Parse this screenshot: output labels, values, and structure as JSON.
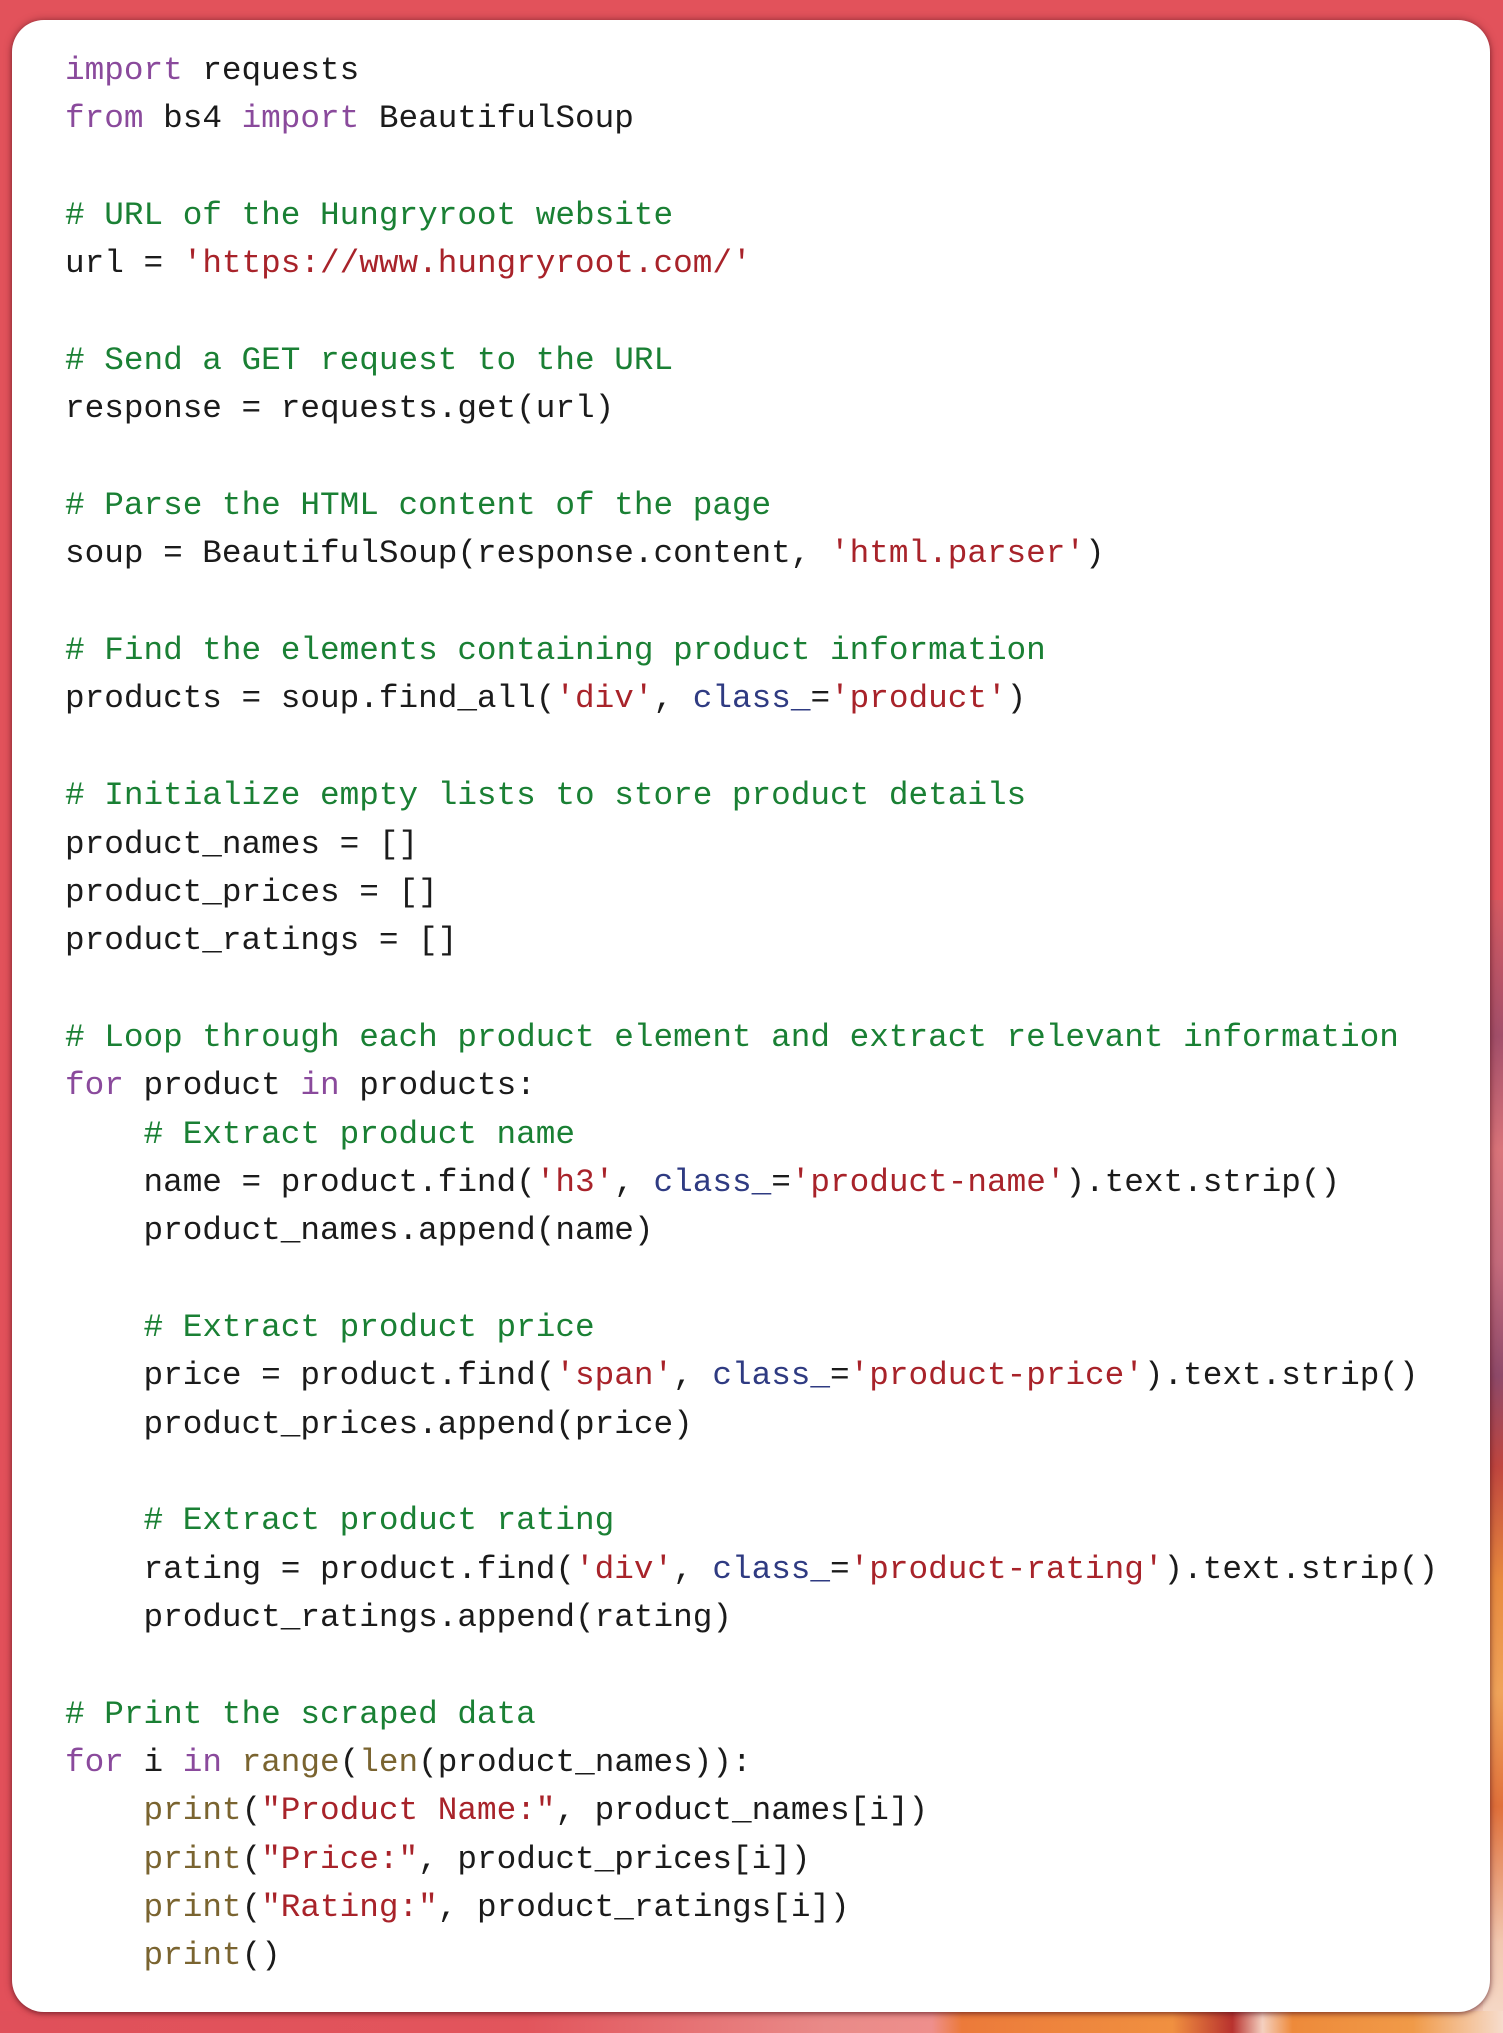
{
  "colors": {
    "keyword": "#8a4a9c",
    "comment": "#1a8034",
    "string": "#a8232a",
    "builtin": "#7a6430",
    "param": "#2f3b82",
    "plain": "#1b1b1b",
    "card_background": "#ffffff",
    "frame_background": "#e2525b"
  },
  "code": {
    "language": "python",
    "lines": [
      [
        [
          "keyword",
          "import"
        ],
        [
          "plain",
          " requests"
        ]
      ],
      [
        [
          "keyword",
          "from"
        ],
        [
          "plain",
          " bs4 "
        ],
        [
          "keyword",
          "import"
        ],
        [
          "plain",
          " BeautifulSoup"
        ]
      ],
      [],
      [
        [
          "comment",
          "# URL of the Hungryroot website"
        ]
      ],
      [
        [
          "plain",
          "url = "
        ],
        [
          "string",
          "'https://www.hungryroot.com/'"
        ]
      ],
      [],
      [
        [
          "comment",
          "# Send a GET request to the URL"
        ]
      ],
      [
        [
          "plain",
          "response = requests.get(url)"
        ]
      ],
      [],
      [
        [
          "comment",
          "# Parse the HTML content of the page"
        ]
      ],
      [
        [
          "plain",
          "soup = BeautifulSoup(response.content, "
        ],
        [
          "string",
          "'html.parser'"
        ],
        [
          "plain",
          ")"
        ]
      ],
      [],
      [
        [
          "comment",
          "# Find the elements containing product information"
        ]
      ],
      [
        [
          "plain",
          "products = soup.find_all("
        ],
        [
          "string",
          "'div'"
        ],
        [
          "plain",
          ", "
        ],
        [
          "param",
          "class_"
        ],
        [
          "plain",
          "="
        ],
        [
          "string",
          "'product'"
        ],
        [
          "plain",
          ")"
        ]
      ],
      [],
      [
        [
          "comment",
          "# Initialize empty lists to store product details"
        ]
      ],
      [
        [
          "plain",
          "product_names = []"
        ]
      ],
      [
        [
          "plain",
          "product_prices = []"
        ]
      ],
      [
        [
          "plain",
          "product_ratings = []"
        ]
      ],
      [],
      [
        [
          "comment",
          "# Loop through each product element and extract relevant information"
        ]
      ],
      [
        [
          "keyword",
          "for"
        ],
        [
          "plain",
          " product "
        ],
        [
          "keyword",
          "in"
        ],
        [
          "plain",
          " products:"
        ]
      ],
      [
        [
          "plain",
          "    "
        ],
        [
          "comment",
          "# Extract product name"
        ]
      ],
      [
        [
          "plain",
          "    name = product.find("
        ],
        [
          "string",
          "'h3'"
        ],
        [
          "plain",
          ", "
        ],
        [
          "param",
          "class_"
        ],
        [
          "plain",
          "="
        ],
        [
          "string",
          "'product-name'"
        ],
        [
          "plain",
          ").text.strip()"
        ]
      ],
      [
        [
          "plain",
          "    product_names.append(name)"
        ]
      ],
      [],
      [
        [
          "plain",
          "    "
        ],
        [
          "comment",
          "# Extract product price"
        ]
      ],
      [
        [
          "plain",
          "    price = product.find("
        ],
        [
          "string",
          "'span'"
        ],
        [
          "plain",
          ", "
        ],
        [
          "param",
          "class_"
        ],
        [
          "plain",
          "="
        ],
        [
          "string",
          "'product-price'"
        ],
        [
          "plain",
          ").text.strip()"
        ]
      ],
      [
        [
          "plain",
          "    product_prices.append(price)"
        ]
      ],
      [],
      [
        [
          "plain",
          "    "
        ],
        [
          "comment",
          "# Extract product rating"
        ]
      ],
      [
        [
          "plain",
          "    rating = product.find("
        ],
        [
          "string",
          "'div'"
        ],
        [
          "plain",
          ", "
        ],
        [
          "param",
          "class_"
        ],
        [
          "plain",
          "="
        ],
        [
          "string",
          "'product-rating'"
        ],
        [
          "plain",
          ").text.strip()"
        ]
      ],
      [
        [
          "plain",
          "    product_ratings.append(rating)"
        ]
      ],
      [],
      [
        [
          "comment",
          "# Print the scraped data"
        ]
      ],
      [
        [
          "keyword",
          "for"
        ],
        [
          "plain",
          " i "
        ],
        [
          "keyword",
          "in"
        ],
        [
          "plain",
          " "
        ],
        [
          "builtin",
          "range"
        ],
        [
          "plain",
          "("
        ],
        [
          "builtin",
          "len"
        ],
        [
          "plain",
          "(product_names)):"
        ]
      ],
      [
        [
          "plain",
          "    "
        ],
        [
          "builtin",
          "print"
        ],
        [
          "plain",
          "("
        ],
        [
          "string",
          "\"Product Name:\""
        ],
        [
          "plain",
          ", product_names[i])"
        ]
      ],
      [
        [
          "plain",
          "    "
        ],
        [
          "builtin",
          "print"
        ],
        [
          "plain",
          "("
        ],
        [
          "string",
          "\"Price:\""
        ],
        [
          "plain",
          ", product_prices[i])"
        ]
      ],
      [
        [
          "plain",
          "    "
        ],
        [
          "builtin",
          "print"
        ],
        [
          "plain",
          "("
        ],
        [
          "string",
          "\"Rating:\""
        ],
        [
          "plain",
          ", product_ratings[i])"
        ]
      ],
      [
        [
          "plain",
          "    "
        ],
        [
          "builtin",
          "print"
        ],
        [
          "plain",
          "()"
        ]
      ]
    ]
  }
}
